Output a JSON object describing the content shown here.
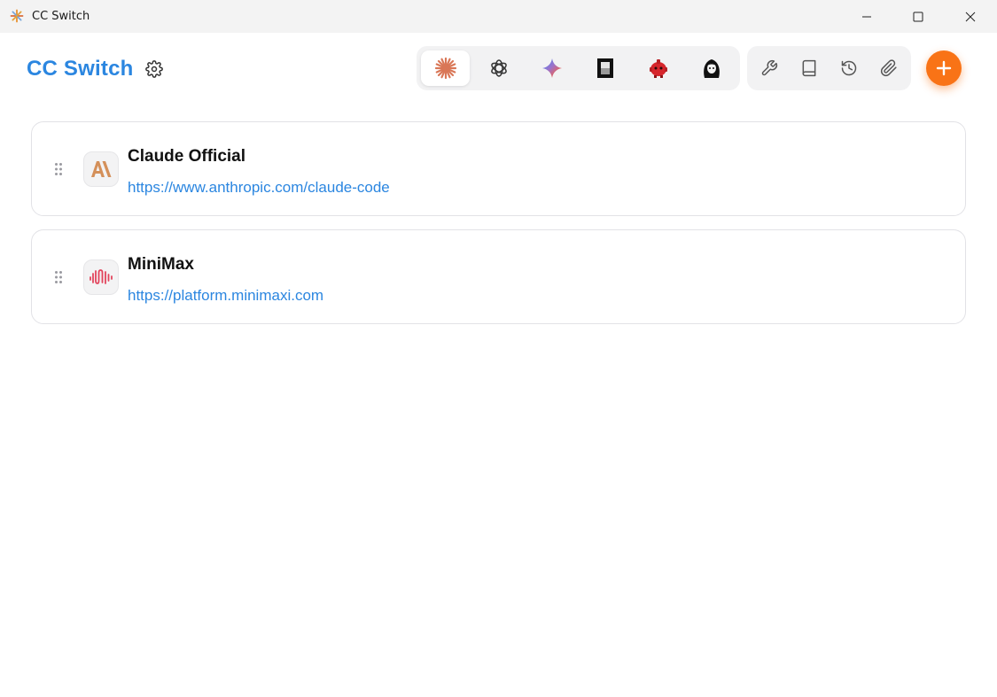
{
  "window": {
    "title": "CC Switch",
    "controls": {
      "minimize": "minimize-icon",
      "maximize": "maximize-icon",
      "close": "close-icon"
    }
  },
  "header": {
    "brand": "CC Switch",
    "settings_icon": "gear-icon"
  },
  "app_switcher": [
    {
      "icon": "claude-icon",
      "active": true
    },
    {
      "icon": "openai-icon",
      "active": false
    },
    {
      "icon": "gemini-icon",
      "active": false
    },
    {
      "icon": "opencode-icon",
      "active": false
    },
    {
      "icon": "red-robot-icon",
      "active": false
    },
    {
      "icon": "avatar-icon",
      "active": false
    }
  ],
  "tools": [
    {
      "icon": "wrench-icon"
    },
    {
      "icon": "book-icon"
    },
    {
      "icon": "history-icon"
    },
    {
      "icon": "paperclip-icon"
    }
  ],
  "add_button": {
    "icon": "plus-icon"
  },
  "providers": [
    {
      "name": "Claude Official",
      "url": "https://www.anthropic.com/claude-code",
      "logo": "anthropic-logo-icon"
    },
    {
      "name": "MiniMax",
      "url": "https://platform.minimaxi.com",
      "logo": "minimax-logo-icon"
    }
  ],
  "colors": {
    "accent": "#2b86e0",
    "add_button": "#f97316",
    "claude": "#d97757",
    "minimax": "#e2445c"
  }
}
